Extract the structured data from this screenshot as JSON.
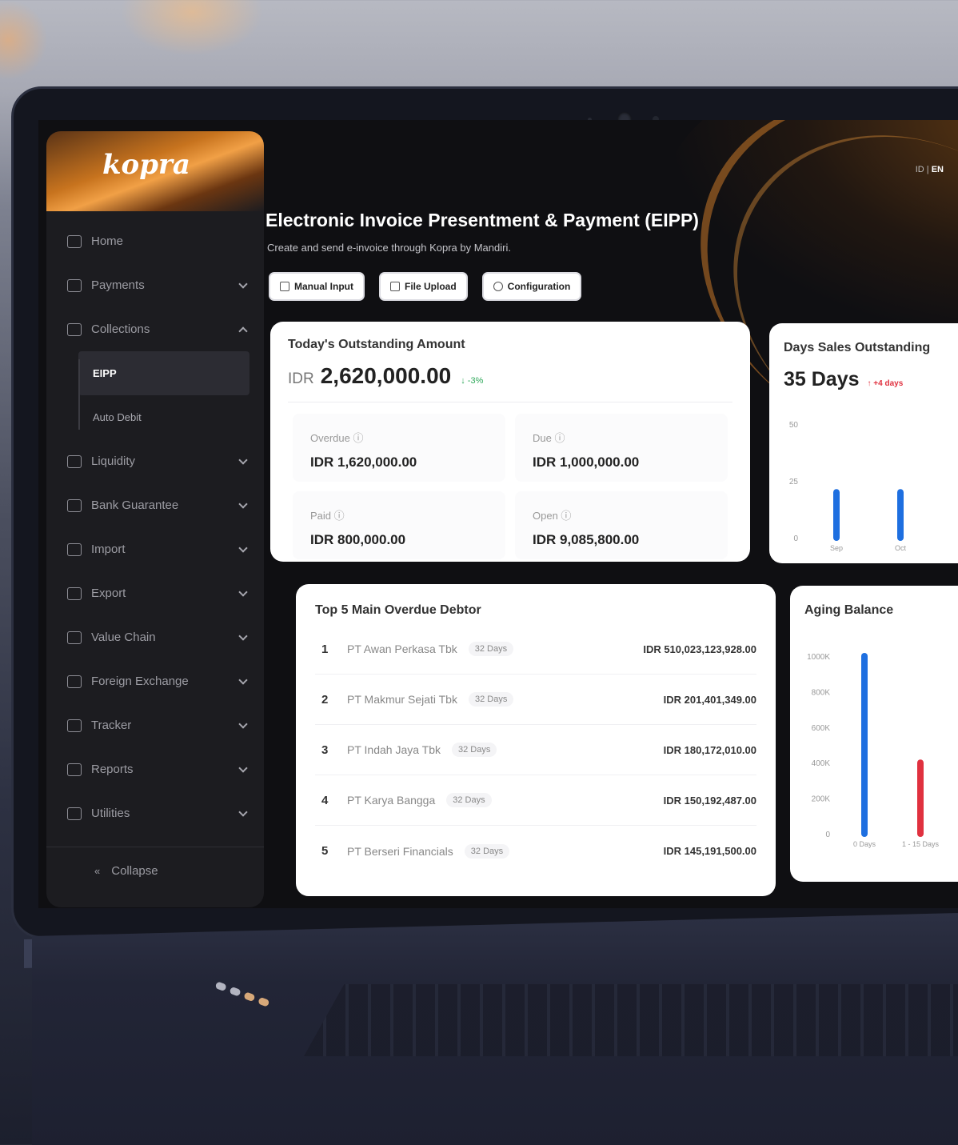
{
  "sidebar": {
    "logo": "kopra",
    "items": [
      {
        "label": "Home",
        "icon": "home-icon",
        "chevron": ""
      },
      {
        "label": "Payments",
        "icon": "payments-icon",
        "chevron": "down"
      },
      {
        "label": "Collections",
        "icon": "collections-icon",
        "chevron": "up"
      }
    ],
    "sub_items": [
      {
        "label": "EIPP",
        "active": true
      },
      {
        "label": "Auto Debit",
        "active": false
      }
    ],
    "items_after": [
      {
        "label": "Liquidity",
        "icon": "liquidity-icon"
      },
      {
        "label": "Bank Guarantee",
        "icon": "bank-guarantee-icon"
      },
      {
        "label": "Import",
        "icon": "import-icon"
      },
      {
        "label": "Export",
        "icon": "export-icon"
      },
      {
        "label": "Value Chain",
        "icon": "value-chain-icon"
      },
      {
        "label": "Foreign Exchange",
        "icon": "foreign-exchange-icon"
      },
      {
        "label": "Tracker",
        "icon": "tracker-icon"
      },
      {
        "label": "Reports",
        "icon": "reports-icon"
      },
      {
        "label": "Utilities",
        "icon": "utilities-icon"
      }
    ],
    "collapse_label": "Collapse"
  },
  "header": {
    "lang_id": "ID",
    "lang_sep": "|",
    "lang_en": "EN",
    "title": "Electronic Invoice Presentment & Payment (EIPP)",
    "subtitle": "Create and send e-invoice through Kopra by Mandiri.",
    "actions": [
      "Manual Input",
      "File Upload",
      "Configuration"
    ]
  },
  "outstanding": {
    "title": "Today's Outstanding Amount",
    "currency": "IDR",
    "amount": "2,620,000.00",
    "change": "↓ -3%",
    "stats": [
      {
        "label": "Overdue ⓘ",
        "value": "IDR 1,620,000.00"
      },
      {
        "label": "Due ⓘ",
        "value": "IDR 1,000,000.00"
      },
      {
        "label": "Paid ⓘ",
        "value": "IDR 800,000.00"
      },
      {
        "label": "Open ⓘ",
        "value": "IDR 9,085,800.00"
      }
    ]
  },
  "dso": {
    "title": "Days Sales Outstanding",
    "value": "35 Days",
    "delta": "↑ +4 days"
  },
  "debtors": {
    "title": "Top 5 Main Overdue Debtor",
    "rows": [
      {
        "idx": "1",
        "name": "PT Awan Perkasa Tbk",
        "days": "32 Days",
        "amount": "IDR 510,023,123,928.00"
      },
      {
        "idx": "2",
        "name": "PT Makmur Sejati Tbk",
        "days": "32 Days",
        "amount": "IDR 201,401,349.00"
      },
      {
        "idx": "3",
        "name": "PT Indah Jaya Tbk",
        "days": "32 Days",
        "amount": "IDR 180,172,010.00"
      },
      {
        "idx": "4",
        "name": "PT Karya Bangga",
        "days": "32 Days",
        "amount": "IDR 150,192,487.00"
      },
      {
        "idx": "5",
        "name": "PT Berseri Financials",
        "days": "32 Days",
        "amount": "IDR 145,191,500.00"
      }
    ]
  },
  "aging": {
    "title": "Aging Balance"
  },
  "colors": {
    "accent_orange": "#e8912f",
    "bar_blue": "#1e6fe0",
    "bar_red": "#e0313f",
    "positive": "#2fa85a"
  },
  "chart_data": [
    {
      "type": "bar",
      "title": "Days Sales Outstanding",
      "categories": [
        "Sep",
        "Oct"
      ],
      "values": [
        20,
        20
      ],
      "yticks": [
        "50",
        "25",
        "0"
      ],
      "ylim": [
        0,
        50
      ]
    },
    {
      "type": "bar",
      "title": "Aging Balance",
      "categories": [
        "0 Days",
        "1 - 15 Days"
      ],
      "values": [
        1000,
        400
      ],
      "yticks": [
        "1000K",
        "800K",
        "600K",
        "400K",
        "200K",
        "0"
      ],
      "ylim": [
        0,
        1000
      ]
    }
  ]
}
